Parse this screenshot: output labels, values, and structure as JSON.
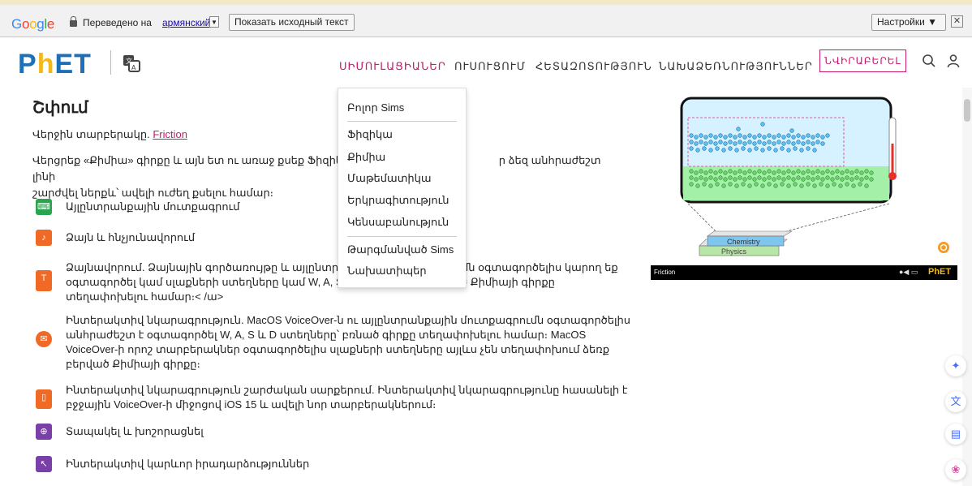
{
  "translate_bar": {
    "google": "Google",
    "translated_to": "Переведено на",
    "language": "армянский",
    "show_original": "Показать исходный текст",
    "settings": "Настройки ▼",
    "close": "✕"
  },
  "header": {
    "logo": "PhET",
    "nav": [
      "ՍԻՄՈՒԼԱՑԻԱՆԵՐ",
      "ՈՒՍՈՒՑՈՒՄ",
      "ՀԵՏԱԶՈՏՈՒԹՅՈՒՆ",
      "ՆԱԽԱՁԵՌՆՈՒԹՅՈՒՆՆԵՐ"
    ],
    "donate": "ՆՎԻՐԱԲԵՐԵԼ"
  },
  "page": {
    "title": "Շփում",
    "latest_label": "Վերջին տարբերակը.",
    "latest_link": "Friction",
    "intro": "Վերցրեք «Քիմիա» գիրքը և այն ետ ու առաջ քսեք Ֆիզիկա գրքի վրա։ Առավելագույն ջերմաստիճանը հասնելու համար, եթե ձեզ անհրաժեշտ լինի շարժվել ներքև՝ ավելի ուժեղ քսելու համար։",
    "intro_line1a": "Վերցրեք «Քիմիա» գիրքը և այն ետ ու առաջ քսեք Ֆիզիկա",
    "intro_line1b": "ր ձեզ անհրաժեշտ լինի",
    "intro_line2": "շարժվել ներքև՝ ավելի ուժեղ քսելու համար։",
    "features": [
      {
        "text": "Այլընտրանքային մուտքագրում"
      },
      {
        "text": "Ձայն և հնչյունավորում"
      },
      {
        "lines": [
          "Ձայնավորում. Ձայնային գործառույթը և այլընտրանքային մուտքագրումն օգտագործելիս կարող եք",
          "օգտագործել կամ սլաքների ստեղները կամ W, A, S և D ստեղները՝ բռնած Քիմիայի գիրքը",
          "տեղափոխելու համար։< /ա>"
        ]
      },
      {
        "lines": [
          "Ինտերակտիվ նկարագրություն. MacOS VoiceOver-ն ու այլընտրանքային մուտքագրումն օգտագործելիս",
          "անհրաժեշտ է օգտագործել W, A, S և D ստեղները՝ բռնած գիրքը տեղափոխելու համար։ MacOS",
          "VoiceOver-ի որոշ տարբերակներ օգտագործելիս սլաքների ստեղները այլևս չեն տեղափոխում ձեռք",
          "բերված Քիմիայի գիրքը։"
        ]
      },
      {
        "lines": [
          "Ինտերակտիվ նկարագրություն շարժական սարքերում. Ինտերակտիվ նկարագրությունը հասանելի է",
          "բջջային VoiceOver-ի միջոցով iOS 15 և ավելի նոր տարբերակներում։"
        ]
      },
      {
        "text": "Տապակել և խոշորացնել"
      },
      {
        "text": "Ինտերակտիվ կարևոր իրադարձություններ"
      }
    ]
  },
  "dropdown": {
    "items_top": [
      "Բոլոր Sims"
    ],
    "items": [
      "Ֆիզիկա",
      "Քիմիա",
      "Մաթեմատիկա",
      "Երկրագիտություն",
      "Կենսաբանություն"
    ],
    "items_bottom": [
      "Թարգմանված Sims",
      "Նախատիպեր"
    ]
  },
  "sim": {
    "book_top": "Chemistry",
    "book_bottom": "Physics",
    "footer_name": "Friction",
    "footer_logo": "PhET"
  },
  "colors": {
    "accent": "#c51a6e",
    "phet_blue": "#1d6fb8",
    "phet_yellow": "#f2b919"
  }
}
